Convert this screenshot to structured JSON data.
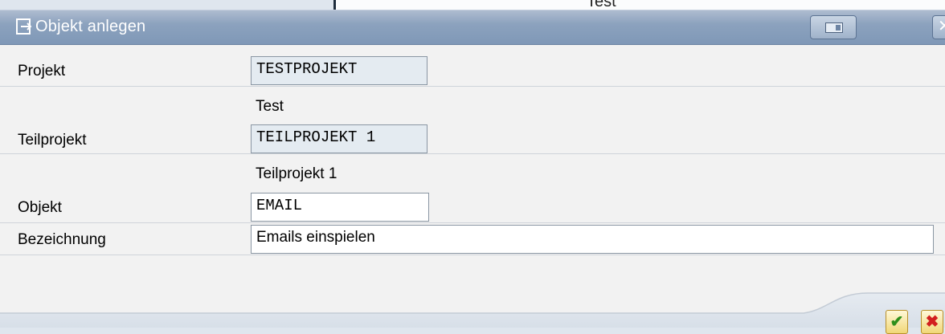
{
  "background_window": {
    "text": "Test"
  },
  "title_bar": {
    "icon": "create-object-icon",
    "title": "Objekt anlegen",
    "buttons": [
      {
        "icon": "layout-toggle-icon"
      },
      {
        "icon": "close-icon",
        "label": "✕"
      }
    ]
  },
  "form": {
    "projekt": {
      "label": "Projekt",
      "value": "TESTPROJEKT",
      "description": "Test"
    },
    "teilprojekt": {
      "label": "Teilprojekt",
      "value": "TEILPROJEKT 1",
      "description": "Teilprojekt 1"
    },
    "objekt": {
      "label": "Objekt",
      "value": "EMAIL"
    },
    "bezeichnung": {
      "label": "Bezeichnung",
      "value": "Emails einspielen"
    }
  },
  "footer": {
    "confirm": {
      "icon": "checkmark-icon",
      "glyph": "✔"
    },
    "cancel": {
      "icon": "cancel-x-icon",
      "glyph": "✖"
    }
  },
  "colors": {
    "titlebar": "#8ca2be",
    "readonly_field": "#e4ebf1",
    "confirm_green": "#2f8f1b",
    "cancel_red": "#d21f1f"
  }
}
